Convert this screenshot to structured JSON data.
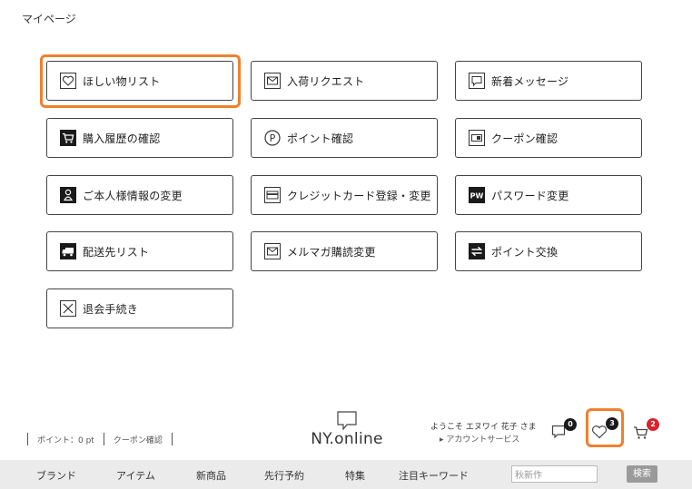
{
  "page_title": "マイページ",
  "menu": [
    {
      "key": "wishlist",
      "label": "ほしい物リスト",
      "icon": "heart-icon"
    },
    {
      "key": "restock",
      "label": "入荷リクエスト",
      "icon": "envelope-icon"
    },
    {
      "key": "messages",
      "label": "新着メッセージ",
      "icon": "speech-bubble-icon"
    },
    {
      "key": "history",
      "label": "購入履歴の確認",
      "icon": "cart-icon"
    },
    {
      "key": "points",
      "label": "ポイント確認",
      "icon": "points-p-icon"
    },
    {
      "key": "coupons",
      "label": "クーポン確認",
      "icon": "coupon-icon"
    },
    {
      "key": "profile",
      "label": "ご本人様情報の変更",
      "icon": "person-icon"
    },
    {
      "key": "credit",
      "label": "クレジットカード登録・変更",
      "icon": "credit-card-icon"
    },
    {
      "key": "password",
      "label": "パスワード変更",
      "icon": "password-pw-icon"
    },
    {
      "key": "address",
      "label": "配送先リスト",
      "icon": "truck-icon"
    },
    {
      "key": "newsletter",
      "label": "メルマガ購読変更",
      "icon": "envelope-icon"
    },
    {
      "key": "exchange",
      "label": "ポイント交換",
      "icon": "exchange-arrows-icon"
    },
    {
      "key": "withdraw",
      "label": "退会手続き",
      "icon": "close-x-icon"
    }
  ],
  "header": {
    "points_text": "ポイント：0 pt",
    "coupon_link": "クーポン確認",
    "logo_text": "NY.online",
    "welcome_text": "ようこそ エヌワイ 花子 さま",
    "account_service": "▸ アカウントサービス",
    "messages_count": "0",
    "favorites_count": "3",
    "cart_count": "2"
  },
  "nav": {
    "items": [
      "ブランド",
      "アイテム",
      "新商品",
      "先行予約",
      "特集",
      "注目キーワード"
    ],
    "search_value": "秋新作",
    "search_button": "検索"
  },
  "colors": {
    "highlight": "#f0802c",
    "cart_badge": "#d9232d",
    "dark_badge": "#1a1a1a",
    "navbar_bg": "#ebebeb"
  }
}
